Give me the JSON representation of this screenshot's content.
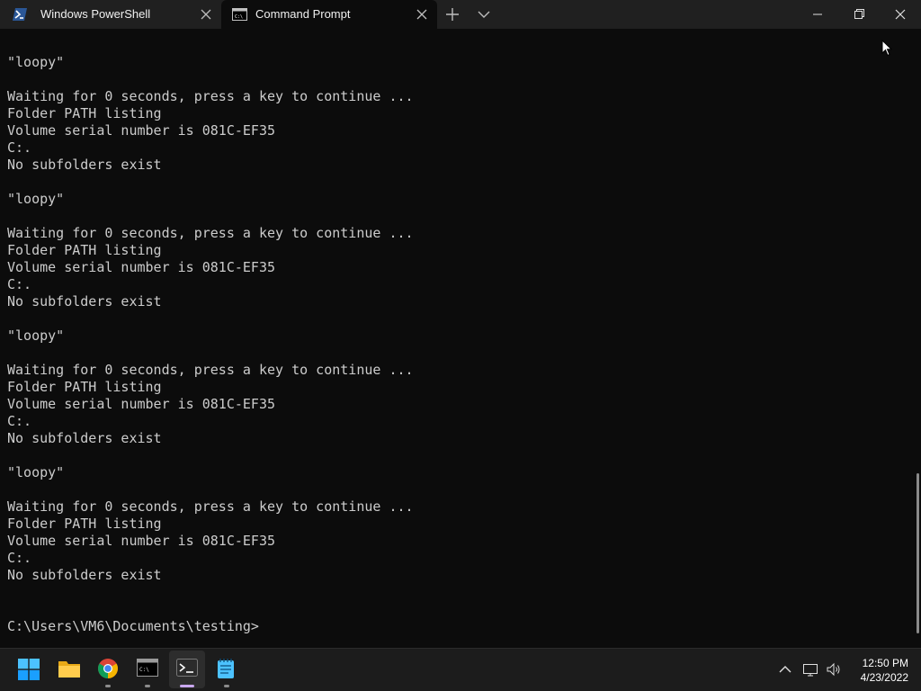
{
  "tabs": [
    {
      "label": "Windows PowerShell",
      "icon": "powershell-icon",
      "active": false
    },
    {
      "label": "Command Prompt",
      "icon": "cmd-icon",
      "active": true
    }
  ],
  "window_controls": [
    "minimize",
    "restore",
    "close"
  ],
  "terminal": {
    "lines": [
      "\"loopy\"",
      "",
      "Waiting for 0 seconds, press a key to continue ...",
      "Folder PATH listing",
      "Volume serial number is 081C-EF35",
      "C:.",
      "No subfolders exist",
      "",
      "\"loopy\"",
      "",
      "Waiting for 0 seconds, press a key to continue ...",
      "Folder PATH listing",
      "Volume serial number is 081C-EF35",
      "C:.",
      "No subfolders exist",
      "",
      "\"loopy\"",
      "",
      "Waiting for 0 seconds, press a key to continue ...",
      "Folder PATH listing",
      "Volume serial number is 081C-EF35",
      "C:.",
      "No subfolders exist",
      "",
      "\"loopy\"",
      "",
      "Waiting for 0 seconds, press a key to continue ...",
      "Folder PATH listing",
      "Volume serial number is 081C-EF35",
      "C:.",
      "No subfolders exist",
      "",
      "",
      "C:\\Users\\VM6\\Documents\\testing>"
    ]
  },
  "taskbar": {
    "apps": [
      {
        "name": "start",
        "icon": "windows-start-icon"
      },
      {
        "name": "file-explorer",
        "icon": "folder-icon"
      },
      {
        "name": "chrome",
        "icon": "chrome-icon"
      },
      {
        "name": "command-prompt",
        "icon": "cmd-icon"
      },
      {
        "name": "terminal",
        "icon": "terminal-icon"
      },
      {
        "name": "notepad",
        "icon": "notepad-icon"
      }
    ],
    "clock": {
      "time": "12:50 PM",
      "date": "4/23/2022"
    }
  },
  "colors": {
    "terminal_bg": "#0c0c0c",
    "terminal_text": "#cccccc",
    "titlebar_bg": "#202020",
    "taskbar_bg": "#1c1c1c",
    "accent": "#c9a7ef"
  }
}
